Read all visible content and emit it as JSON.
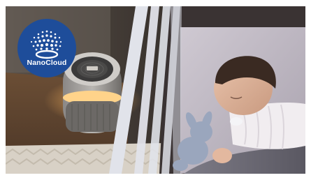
{
  "badge": {
    "label": "NanoCloud",
    "background_color": "#1e4d9a",
    "icon": "nanocloud-icon"
  },
  "scene": {
    "subject": "air-purifier-photo",
    "purifier_glow_color": "#f2c27a",
    "wall_color": "#3a3531",
    "crib_color": "#d9dbe2"
  }
}
